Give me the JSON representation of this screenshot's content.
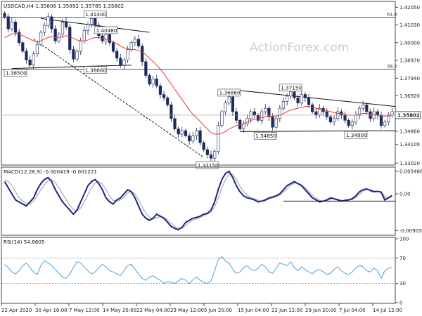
{
  "watermark": "ActionForex.com",
  "colors": {
    "candles": "#1f2a5c",
    "ma": "#e53935",
    "trendline": "#111111",
    "hline": "#222222",
    "label_bg": "#ffffff",
    "macd": "#1c2580",
    "signal": "#9a9aaa",
    "rsi": "#4aa3e0",
    "rsi_level": "#666666",
    "grid_border": "#444444"
  },
  "chart_data": [
    {
      "type": "candlestick",
      "panel": "price",
      "header": "USDCAD,H4  1.35808 1.35892 1.35785 1.35802",
      "current_price": "1.35802",
      "ylim": [
        1.3295,
        1.4235
      ],
      "y_ticks": [
        "1.42050",
        "1.41030",
        "1.40000",
        "1.38970",
        "1.37940",
        "1.36920",
        "1.35890",
        "1.34860",
        "1.34100",
        "1.33020"
      ],
      "x_labels": [
        "22 Apr 2020",
        "30 Apr 16:00",
        "7 May 12:00",
        "14 May 20:00",
        "22 May 04:00",
        "29 May 12:00",
        "5 Jun 20:00",
        "15 Jun 04:00",
        "22 Jun 12:00",
        "29 Jun 20:00",
        "7 Jul 04:00",
        "14 Jul 12:00"
      ],
      "close_series": [
        1.415,
        1.408,
        1.412,
        1.406,
        1.4,
        1.395,
        1.39,
        1.387,
        1.3935,
        1.399,
        1.406,
        1.41,
        1.415,
        1.408,
        1.401,
        1.405,
        1.412,
        1.409,
        1.396,
        1.3905,
        1.395,
        1.401,
        1.407,
        1.4105,
        1.414,
        1.41,
        1.404,
        1.401,
        1.4048,
        1.4,
        1.395,
        1.391,
        1.387,
        1.39,
        1.396,
        1.4,
        1.402,
        1.398,
        1.389,
        1.381,
        1.376,
        1.379,
        1.375,
        1.37,
        1.368,
        1.364,
        1.356,
        1.35,
        1.347,
        1.349,
        1.346,
        1.343,
        1.346,
        1.349,
        1.342,
        1.338,
        1.335,
        1.333,
        1.337,
        1.352,
        1.36,
        1.365,
        1.3686,
        1.36,
        1.355,
        1.35,
        1.353,
        1.356,
        1.36,
        1.358,
        1.355,
        1.36,
        1.362,
        1.357,
        1.351,
        1.356,
        1.362,
        1.366,
        1.369,
        1.3715,
        1.368,
        1.365,
        1.37,
        1.368,
        1.364,
        1.36,
        1.358,
        1.362,
        1.36,
        1.357,
        1.354,
        1.356,
        1.36,
        1.358,
        1.355,
        1.352,
        1.354,
        1.358,
        1.362,
        1.364,
        1.36,
        1.356,
        1.36,
        1.358,
        1.352,
        1.354,
        1.358,
        1.36
      ],
      "ma_series": [
        1.403,
        1.404,
        1.405,
        1.4055,
        1.405,
        1.404,
        1.403,
        1.402,
        1.401,
        1.4005,
        1.401,
        1.402,
        1.403,
        1.4035,
        1.403,
        1.403,
        1.4035,
        1.404,
        1.4035,
        1.4025,
        1.4015,
        1.401,
        1.401,
        1.4015,
        1.4025,
        1.403,
        1.403,
        1.4025,
        1.402,
        1.4015,
        1.4005,
        1.3995,
        1.398,
        1.397,
        1.3965,
        1.396,
        1.396,
        1.3955,
        1.3945,
        1.393,
        1.391,
        1.389,
        1.387,
        1.3845,
        1.382,
        1.379,
        1.376,
        1.373,
        1.37,
        1.367,
        1.364,
        1.361,
        1.3585,
        1.3565,
        1.3545,
        1.352,
        1.35,
        1.348,
        1.347,
        1.347,
        1.3475,
        1.3485,
        1.35,
        1.351,
        1.352,
        1.3525,
        1.353,
        1.354,
        1.355,
        1.3555,
        1.356,
        1.3565,
        1.357,
        1.3575,
        1.3575,
        1.3575,
        1.358,
        1.359,
        1.36,
        1.361,
        1.3615,
        1.362,
        1.3625,
        1.363,
        1.363,
        1.3625,
        1.362,
        1.3615,
        1.361,
        1.3605,
        1.36,
        1.3595,
        1.359,
        1.359,
        1.3585,
        1.358,
        1.358,
        1.358,
        1.3585,
        1.359,
        1.359,
        1.3585,
        1.3585,
        1.358,
        1.3575,
        1.3575,
        1.3575,
        1.358
      ],
      "fib_levels": [
        {
          "label": "61.8",
          "price": 1.4148
        },
        {
          "label": "38.2",
          "price": 1.3847
        }
      ],
      "level_labels": [
        {
          "text": "1.41400",
          "price": 1.414,
          "bar": 25
        },
        {
          "text": "1.40480",
          "price": 1.4048,
          "bar": 28
        },
        {
          "text": "1.38660",
          "price": 1.3866,
          "bar": 25
        },
        {
          "text": "1.38500",
          "price": 1.385,
          "bar": 3
        },
        {
          "text": "1.36860",
          "price": 1.3686,
          "bar": 62
        },
        {
          "text": "1.37150",
          "price": 1.3715,
          "bar": 79
        },
        {
          "text": "1.34850",
          "price": 1.3485,
          "bar": 72
        },
        {
          "text": "1.34900",
          "price": 1.349,
          "bar": 97
        },
        {
          "text": "1.33150",
          "price": 1.3315,
          "bar": 56
        }
      ]
    },
    {
      "type": "line",
      "panel": "macd",
      "header": "MACD(12,26,9) -0.000419 -0.001221",
      "ylim": [
        -0.01,
        0.0062
      ],
      "y_ticks": [
        "0.005486",
        "0.00",
        "-0.009034"
      ],
      "macd_series": [
        0.003,
        0.0015,
        0.0,
        -0.0015,
        -0.002,
        -0.0025,
        -0.003,
        -0.002,
        -0.001,
        0.001,
        0.0025,
        0.0035,
        0.004,
        0.003,
        0.001,
        -0.0005,
        -0.002,
        -0.003,
        -0.004,
        -0.005,
        -0.004,
        -0.002,
        0.0,
        0.002,
        0.003,
        0.0035,
        0.0025,
        0.001,
        -0.001,
        -0.002,
        -0.0025,
        -0.0015,
        -0.001,
        0.0,
        0.001,
        0.0005,
        -0.001,
        -0.003,
        -0.005,
        -0.006,
        -0.0065,
        -0.006,
        -0.005,
        -0.0055,
        -0.006,
        -0.007,
        -0.008,
        -0.0085,
        -0.0088,
        -0.0082,
        -0.007,
        -0.0065,
        -0.006,
        -0.0058,
        -0.0055,
        -0.005,
        -0.0048,
        -0.004,
        -0.002,
        0.001,
        0.0035,
        0.005,
        0.0055,
        0.004,
        0.002,
        0.0005,
        -0.0005,
        -0.001,
        -0.0012,
        -0.0015,
        -0.002,
        -0.0018,
        -0.0015,
        -0.001,
        -0.0008,
        -0.0005,
        0.0,
        0.001,
        0.002,
        0.0025,
        0.003,
        0.0025,
        0.002,
        0.001,
        0.0,
        -0.001,
        -0.0015,
        -0.002,
        -0.0018,
        -0.0015,
        -0.001,
        -0.0012,
        -0.0015,
        -0.0018,
        -0.0016,
        -0.0015,
        -0.0012,
        -0.0005,
        0.0005,
        0.001,
        0.0012,
        0.0008,
        0.0005,
        0.0006,
        0.0004,
        -0.0015,
        -0.001,
        -0.0004
      ],
      "signal_series": [
        0.0035,
        0.003,
        0.002,
        0.0005,
        -0.001,
        -0.0018,
        -0.0024,
        -0.0025,
        -0.0018,
        -0.0005,
        0.001,
        0.0022,
        0.0032,
        0.0035,
        0.0028,
        0.0015,
        0.0,
        -0.0015,
        -0.0028,
        -0.0038,
        -0.0042,
        -0.0035,
        -0.002,
        -0.0002,
        0.0014,
        0.0026,
        0.003,
        0.0024,
        0.001,
        -0.0005,
        -0.0016,
        -0.0018,
        -0.0015,
        -0.0008,
        0.0002,
        0.0006,
        0.0,
        -0.0015,
        -0.0032,
        -0.0048,
        -0.0058,
        -0.0062,
        -0.0058,
        -0.0056,
        -0.0058,
        -0.0064,
        -0.0072,
        -0.008,
        -0.0085,
        -0.0085,
        -0.0078,
        -0.007,
        -0.0065,
        -0.0061,
        -0.0058,
        -0.0054,
        -0.005,
        -0.0045,
        -0.0032,
        -0.001,
        0.0015,
        0.0035,
        0.0048,
        0.0048,
        0.0035,
        0.0018,
        0.0005,
        -0.0004,
        -0.0009,
        -0.0012,
        -0.0016,
        -0.0018,
        -0.0017,
        -0.0013,
        -0.001,
        -0.0007,
        -0.0003,
        0.0004,
        0.0013,
        0.0021,
        0.0026,
        0.0026,
        0.0022,
        0.0015,
        0.0006,
        -0.0004,
        -0.001,
        -0.0016,
        -0.0018,
        -0.0017,
        -0.0013,
        -0.0012,
        -0.0013,
        -0.0016,
        -0.0017,
        -0.0016,
        -0.0014,
        -0.0009,
        -0.0001,
        0.0006,
        0.001,
        0.001,
        0.0007,
        0.0006,
        0.0005,
        -0.0007,
        -0.001,
        -0.0007
      ],
      "support_level": -0.0018
    },
    {
      "type": "line",
      "panel": "rsi",
      "header": "RSI(14) 54.6605",
      "ylim": [
        0,
        100
      ],
      "y_ticks": [
        "100",
        "70",
        "30",
        "0"
      ],
      "levels": [
        70,
        30
      ],
      "rsi_series": [
        60,
        55,
        48,
        45,
        50,
        58,
        62,
        55,
        48,
        44,
        58,
        66,
        62,
        58,
        52,
        46,
        40,
        38,
        45,
        55,
        64,
        62,
        55,
        50,
        45,
        48,
        55,
        60,
        56,
        50,
        48,
        45,
        42,
        50,
        58,
        60,
        52,
        45,
        38,
        35,
        40,
        42,
        38,
        35,
        30,
        33,
        32,
        30,
        34,
        38,
        35,
        30,
        36,
        40,
        35,
        32,
        30,
        34,
        50,
        68,
        72,
        65,
        62,
        52,
        46,
        48,
        55,
        58,
        52,
        50,
        54,
        60,
        56,
        48,
        46,
        54,
        62,
        60,
        58,
        64,
        55,
        50,
        56,
        52,
        48,
        45,
        50,
        52,
        48,
        44,
        46,
        52,
        56,
        50,
        46,
        44,
        48,
        54,
        58,
        56,
        50,
        48,
        54,
        50,
        38,
        50,
        54,
        55
      ]
    }
  ]
}
